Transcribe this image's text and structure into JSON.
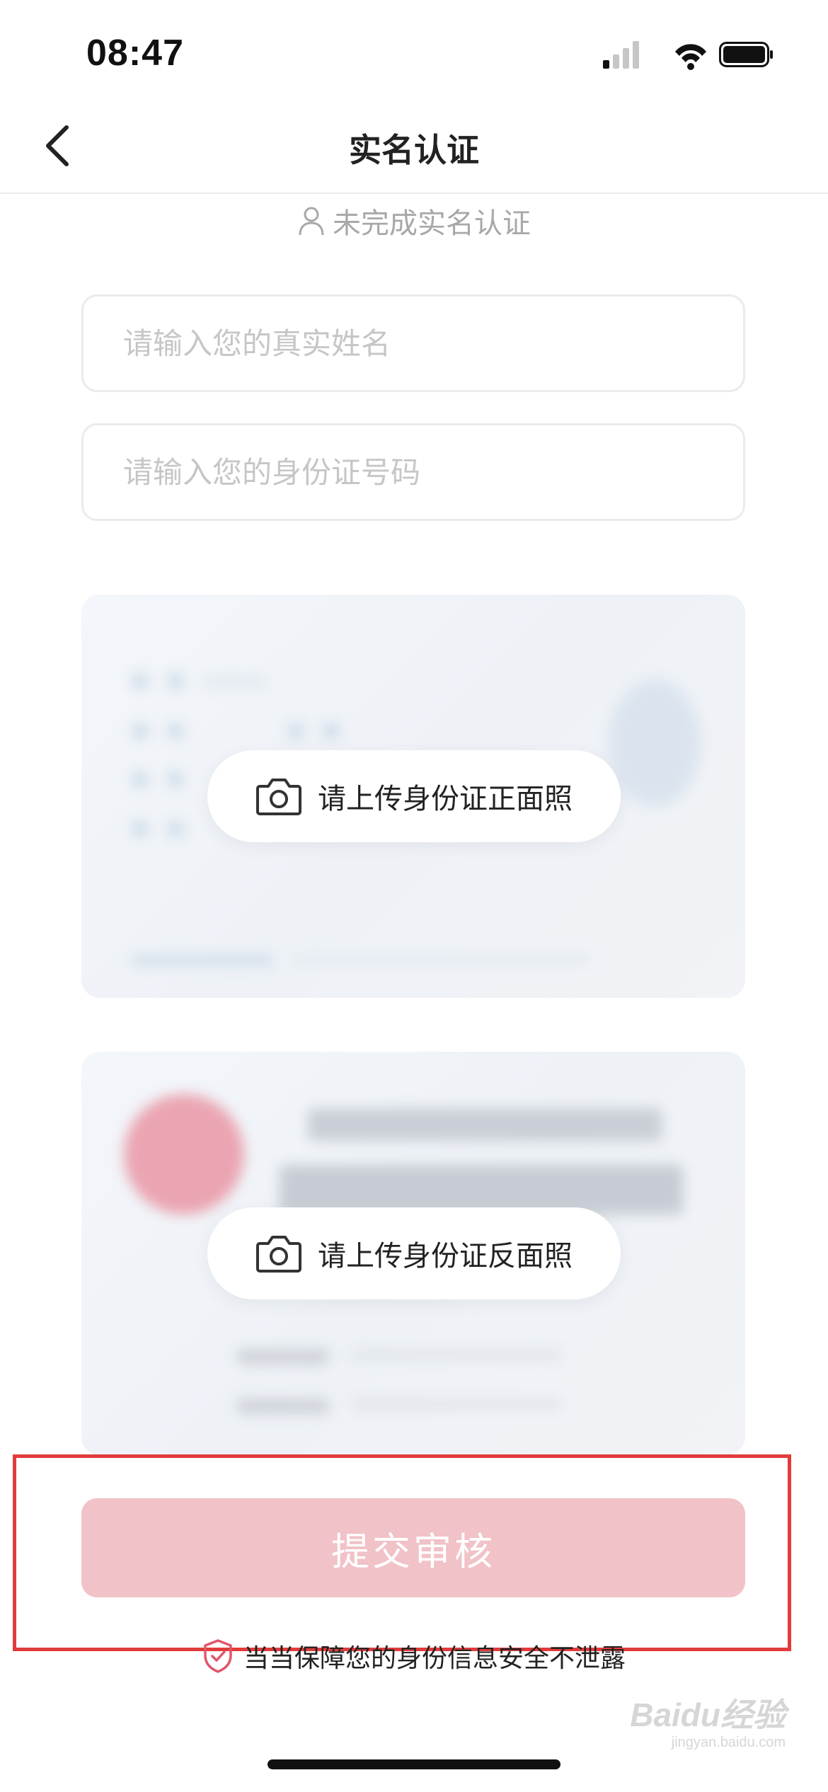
{
  "status_bar": {
    "time": "08:47",
    "icons": [
      "cellular-signal-icon",
      "wifi-icon",
      "battery-icon"
    ]
  },
  "nav": {
    "back_icon": "chevron-left-icon",
    "title": "实名认证"
  },
  "verify_status": {
    "icon": "user-icon",
    "text": "未完成实名认证"
  },
  "form": {
    "name_placeholder": "请输入您的真实姓名",
    "name_value": "",
    "id_placeholder": "请输入您的身份证号码",
    "id_value": ""
  },
  "uploads": {
    "front": {
      "icon": "camera-icon",
      "label": "请上传身份证正面照"
    },
    "back": {
      "icon": "camera-icon",
      "label": "请上传身份证反面照"
    }
  },
  "submit": {
    "label": "提交审核"
  },
  "privacy": {
    "icon": "shield-check-icon",
    "text": "当当保障您的身份信息安全不泄露"
  },
  "watermark": {
    "brand": "Baidu经验",
    "url": "jingyan.baidu.com"
  },
  "colors": {
    "accent_disabled": "#f1c2c7",
    "highlight_frame": "#e23b3b",
    "shield": "#e0566a",
    "emblem": "#e88a9a"
  }
}
